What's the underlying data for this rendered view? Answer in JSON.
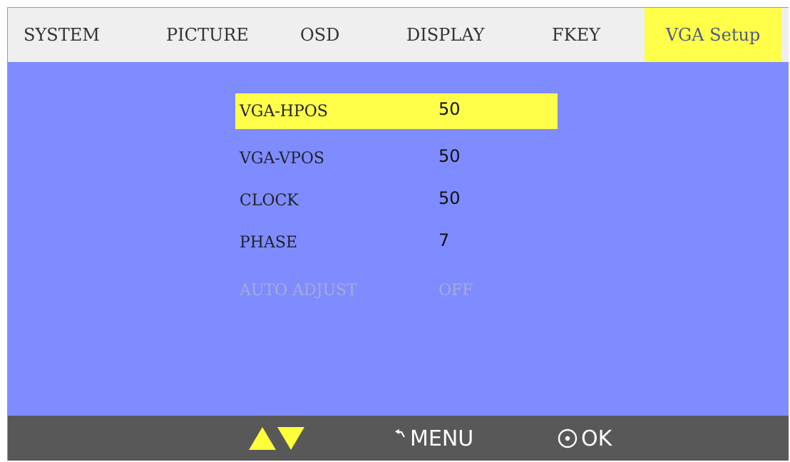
{
  "tabs": [
    {
      "label": "SYSTEM"
    },
    {
      "label": "PICTURE"
    },
    {
      "label": "OSD"
    },
    {
      "label": "DISPLAY"
    },
    {
      "label": "FKEY"
    },
    {
      "label": "VGA Setup",
      "active": true
    }
  ],
  "menu": {
    "items": [
      {
        "label": "VGA-HPOS",
        "value": "50",
        "selected": true
      },
      {
        "label": "VGA-VPOS",
        "value": "50"
      },
      {
        "label": "CLOCK",
        "value": "50"
      },
      {
        "label": "PHASE",
        "value": "7"
      },
      {
        "label": "AUTO ADJUST",
        "value": "OFF",
        "disabled": true
      }
    ]
  },
  "footer": {
    "nav_icon": "up-down-arrows-icon",
    "menu_icon": "back-arrow-icon",
    "menu_label": "MENU",
    "ok_icon": "circle-dot-icon",
    "ok_label": "OK"
  },
  "colors": {
    "tab_bar": "#efefef",
    "active_tab": "#ffff49",
    "panel": "#7f8cff",
    "selection": "#ffff49",
    "footer": "#585858",
    "arrows": "#ffff3a"
  }
}
